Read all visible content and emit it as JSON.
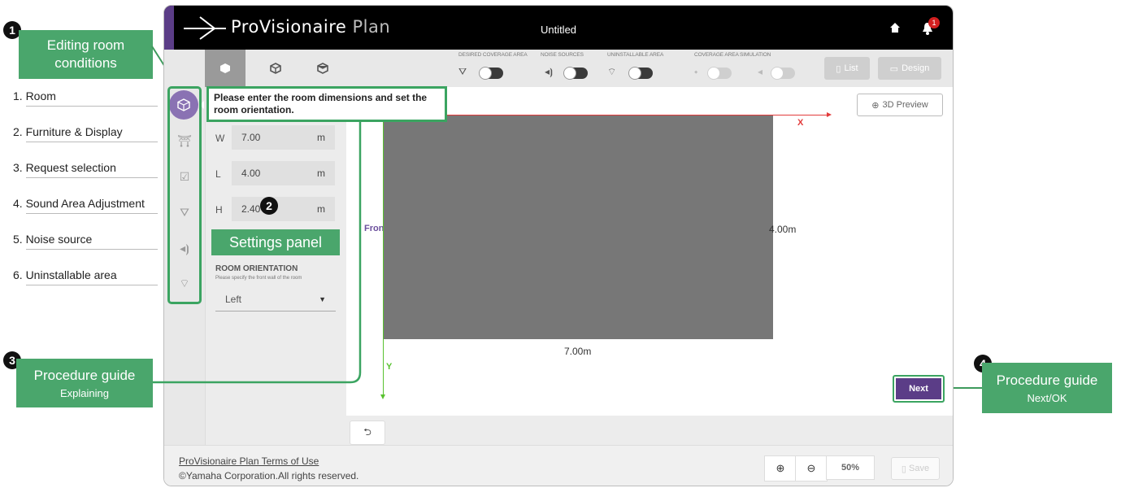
{
  "app": {
    "logo_prefix": "ProVisionaire",
    "logo_suffix": "Plan",
    "document_title": "Untitled",
    "notification_count": "1"
  },
  "toolbar": {
    "toggle_labels": [
      "DESIRED COVERAGE AREA",
      "NOISE SOURCES",
      "UNINSTALLABLE AREA",
      "COVERAGE AREA SIMULATION"
    ],
    "list_label": "List",
    "design_label": "Design",
    "preview_label": "3D Preview"
  },
  "guide": {
    "message": "Please enter the room dimensions and set the room orientation."
  },
  "settings": {
    "fields": [
      {
        "label": "W",
        "value": "7.00",
        "unit": "m"
      },
      {
        "label": "L",
        "value": "4.00",
        "unit": "m"
      },
      {
        "label": "H",
        "value": "2.40",
        "unit": "m"
      }
    ],
    "orientation_title": "ROOM ORIENTATION",
    "orientation_hint": "Please specify the front wall of the room",
    "orientation_value": "Left"
  },
  "canvas": {
    "x_axis": "X",
    "y_axis": "Y",
    "front_label": "Front",
    "width_label": "7.00m",
    "length_label": "4.00m",
    "next_label": "Next"
  },
  "footer": {
    "terms_link": "ProVisionaire Plan Terms of Use",
    "copyright": "©Yamaha Corporation.All rights reserved.",
    "zoom_level": "50%",
    "save_label": "Save"
  },
  "annotations": {
    "editing_title": "Editing room conditions",
    "settings_panel": "Settings panel",
    "procedure_guide": "Procedure guide",
    "explaining": "Explaining",
    "next_ok": "Next/OK",
    "numbers": [
      "1",
      "2",
      "3",
      "4"
    ],
    "steps": [
      "1. Room",
      "2. Furniture & Display",
      "3. Request selection",
      "4. Sound Area Adjustment",
      "5. Noise source",
      "6. Uninstallable area"
    ]
  },
  "colors": {
    "accent_purple": "#5b3d87",
    "annotation_green": "#4aa66c",
    "room_fill": "#777777",
    "x_axis": "#e23b3b",
    "y_axis": "#58c22f"
  }
}
